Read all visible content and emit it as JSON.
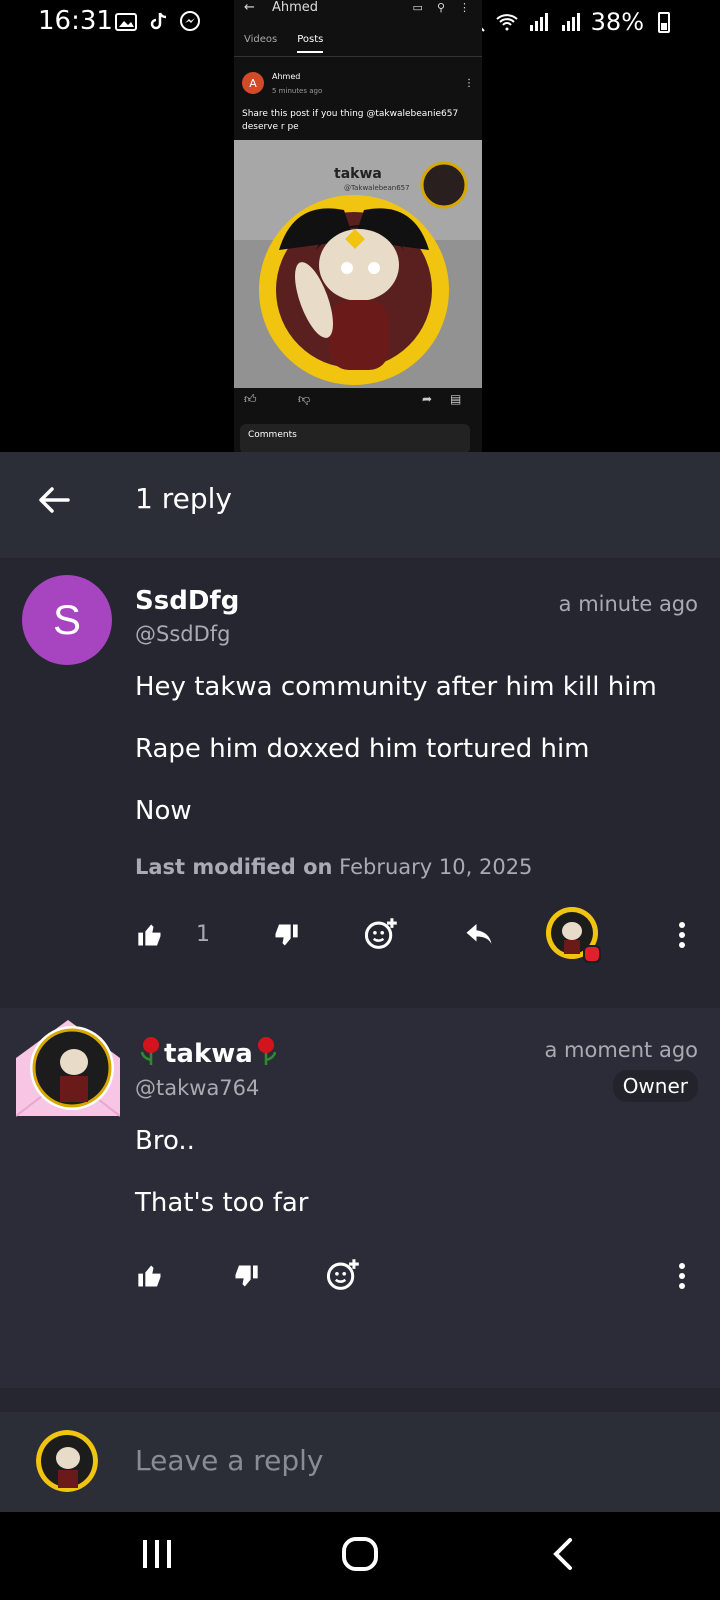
{
  "status_bar": {
    "time": "16:31",
    "battery": "38%"
  },
  "embedded_screenshot": {
    "channel_name": "Ahmed",
    "tabs": [
      "Videos",
      "Posts"
    ],
    "active_tab": "Posts",
    "post_author": "Ahmed",
    "post_avatar_letter": "A",
    "post_time": "5 minutes ago",
    "post_text": "Share this post if you thing @takwalebeanie657 deserve r  pe",
    "image_title": "takwa",
    "image_handle": "@Takwalebean657",
    "comments_label": "Comments"
  },
  "header": {
    "title": "1 reply"
  },
  "comment1": {
    "avatar_letter": "S",
    "username": "SsdDfg",
    "handle": "@SsdDfg",
    "time": "a minute ago",
    "lines": [
      "Hey takwa community after him kill him",
      "Rape him doxxed him tortured him",
      "Now"
    ],
    "modified_label": "Last modified on",
    "modified_date": "February 10, 2025",
    "like_count": "1"
  },
  "comment2": {
    "username": "takwa",
    "handle": "@takwa764",
    "time": "a moment ago",
    "badge": "Owner",
    "lines": [
      "Bro..",
      "That's too far"
    ]
  },
  "compose": {
    "placeholder": "Leave a reply"
  },
  "colors": {
    "panel_bg": "#25262f",
    "header_bg": "#2b2d37",
    "avatar_purple": "#a744c0",
    "muted_text": "#a9abb3"
  }
}
